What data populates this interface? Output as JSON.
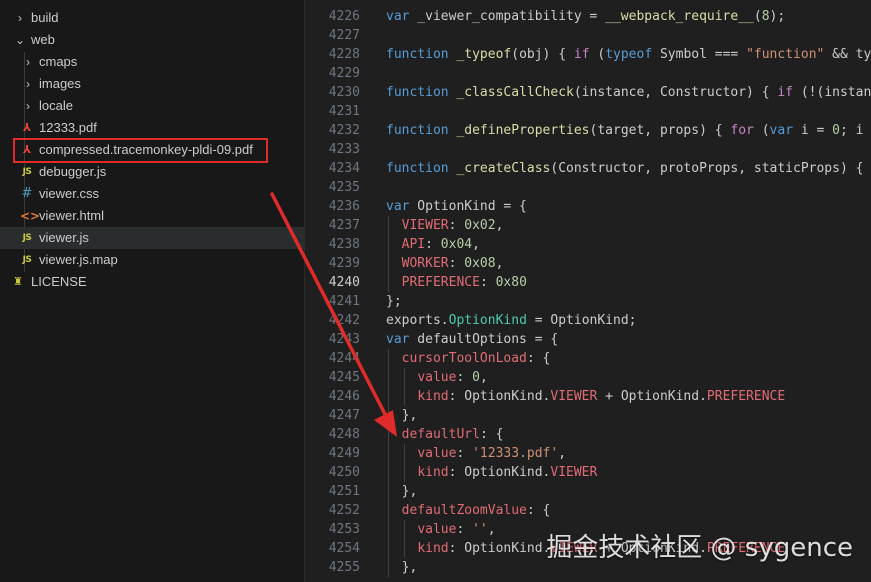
{
  "explorer": {
    "items": [
      {
        "label": "build",
        "chevron": "›",
        "icon": ""
      },
      {
        "label": "web",
        "chevron": "⌄",
        "icon": ""
      },
      {
        "label": "cmaps",
        "chevron": "›",
        "icon": ""
      },
      {
        "label": "images",
        "chevron": "›",
        "icon": ""
      },
      {
        "label": "locale",
        "chevron": "›",
        "icon": ""
      },
      {
        "label": "12333.pdf",
        "chevron": "",
        "icon": "⅄"
      },
      {
        "label": "compressed.tracemonkey-pldi-09.pdf",
        "chevron": "",
        "icon": "⅄"
      },
      {
        "label": "debugger.js",
        "chevron": "",
        "icon": "JS"
      },
      {
        "label": "viewer.css",
        "chevron": "",
        "icon": "#"
      },
      {
        "label": "viewer.html",
        "chevron": "",
        "icon": "<>"
      },
      {
        "label": "viewer.js",
        "chevron": "",
        "icon": "JS"
      },
      {
        "label": "viewer.js.map",
        "chevron": "",
        "icon": "JS"
      },
      {
        "label": "LICENSE",
        "chevron": "",
        "icon": "♜"
      }
    ]
  },
  "editor": {
    "lines": [
      {
        "n": "4226",
        "t": [
          [
            "kw",
            "var"
          ],
          [
            "pun",
            " _viewer_compatibility = "
          ],
          [
            "fn",
            "__webpack_require__"
          ],
          [
            "pun",
            "("
          ],
          [
            "num",
            "8"
          ],
          [
            "pun",
            ");"
          ]
        ]
      },
      {
        "n": "4227",
        "t": []
      },
      {
        "n": "4228",
        "t": [
          [
            "kw",
            "function"
          ],
          [
            "pun",
            " "
          ],
          [
            "fn",
            "_typeof"
          ],
          [
            "pun",
            "(obj) { "
          ],
          [
            "ctrl",
            "if"
          ],
          [
            "pun",
            " ("
          ],
          [
            "kw",
            "typeof"
          ],
          [
            "pun",
            " Symbol === "
          ],
          [
            "str",
            "\"function\""
          ],
          [
            "pun",
            " && typ"
          ]
        ]
      },
      {
        "n": "4229",
        "t": []
      },
      {
        "n": "4230",
        "t": [
          [
            "kw",
            "function"
          ],
          [
            "pun",
            " "
          ],
          [
            "fn",
            "_classCallCheck"
          ],
          [
            "pun",
            "(instance, Constructor) { "
          ],
          [
            "ctrl",
            "if"
          ],
          [
            "pun",
            " (!(instanc"
          ]
        ]
      },
      {
        "n": "4231",
        "t": []
      },
      {
        "n": "4232",
        "t": [
          [
            "kw",
            "function"
          ],
          [
            "pun",
            " "
          ],
          [
            "fn",
            "_defineProperties"
          ],
          [
            "pun",
            "(target, props) { "
          ],
          [
            "ctrl",
            "for"
          ],
          [
            "pun",
            " ("
          ],
          [
            "kw",
            "var"
          ],
          [
            "pun",
            " i = "
          ],
          [
            "num",
            "0"
          ],
          [
            "pun",
            "; i <"
          ]
        ]
      },
      {
        "n": "4233",
        "t": []
      },
      {
        "n": "4234",
        "t": [
          [
            "kw",
            "function"
          ],
          [
            "pun",
            " "
          ],
          [
            "fn",
            "_createClass"
          ],
          [
            "pun",
            "(Constructor, protoProps, staticProps) { i"
          ]
        ]
      },
      {
        "n": "4235",
        "t": []
      },
      {
        "n": "4236",
        "t": [
          [
            "kw",
            "var"
          ],
          [
            "pun",
            " OptionKind = {"
          ]
        ]
      },
      {
        "n": "4237",
        "t": [
          [
            "pun",
            "  "
          ],
          [
            "prop",
            "VIEWER"
          ],
          [
            "pun",
            ": "
          ],
          [
            "num",
            "0x02"
          ],
          [
            "pun",
            ","
          ]
        ]
      },
      {
        "n": "4238",
        "t": [
          [
            "pun",
            "  "
          ],
          [
            "prop",
            "API"
          ],
          [
            "pun",
            ": "
          ],
          [
            "num",
            "0x04"
          ],
          [
            "pun",
            ","
          ]
        ]
      },
      {
        "n": "4239",
        "t": [
          [
            "pun",
            "  "
          ],
          [
            "prop",
            "WORKER"
          ],
          [
            "pun",
            ": "
          ],
          [
            "num",
            "0x08"
          ],
          [
            "pun",
            ","
          ]
        ]
      },
      {
        "n": "4240",
        "t": [
          [
            "pun",
            "  "
          ],
          [
            "prop",
            "PREFERENCE"
          ],
          [
            "pun",
            ": "
          ],
          [
            "num",
            "0x80"
          ]
        ]
      },
      {
        "n": "4241",
        "t": [
          [
            "pun",
            "};"
          ]
        ]
      },
      {
        "n": "4242",
        "t": [
          [
            "pun",
            "exports."
          ],
          [
            "cls",
            "OptionKind"
          ],
          [
            "pun",
            " = OptionKind;"
          ]
        ]
      },
      {
        "n": "4243",
        "t": [
          [
            "kw",
            "var"
          ],
          [
            "pun",
            " defaultOptions = {"
          ]
        ]
      },
      {
        "n": "4244",
        "t": [
          [
            "pun",
            "  "
          ],
          [
            "prop",
            "cursorToolOnLoad"
          ],
          [
            "pun",
            ": {"
          ]
        ]
      },
      {
        "n": "4245",
        "t": [
          [
            "pun",
            "    "
          ],
          [
            "prop",
            "value"
          ],
          [
            "pun",
            ": "
          ],
          [
            "num",
            "0"
          ],
          [
            "pun",
            ","
          ]
        ]
      },
      {
        "n": "4246",
        "t": [
          [
            "pun",
            "    "
          ],
          [
            "prop",
            "kind"
          ],
          [
            "pun",
            ": OptionKind."
          ],
          [
            "prop",
            "VIEWER"
          ],
          [
            "pun",
            " + OptionKind."
          ],
          [
            "prop",
            "PREFERENCE"
          ]
        ]
      },
      {
        "n": "4247",
        "t": [
          [
            "pun",
            "  },"
          ]
        ]
      },
      {
        "n": "4248",
        "t": [
          [
            "pun",
            "  "
          ],
          [
            "prop",
            "defaultUrl"
          ],
          [
            "pun",
            ": {"
          ]
        ]
      },
      {
        "n": "4249",
        "t": [
          [
            "pun",
            "    "
          ],
          [
            "prop",
            "value"
          ],
          [
            "pun",
            ": "
          ],
          [
            "str",
            "'12333.pdf'"
          ],
          [
            "pun",
            ","
          ]
        ]
      },
      {
        "n": "4250",
        "t": [
          [
            "pun",
            "    "
          ],
          [
            "prop",
            "kind"
          ],
          [
            "pun",
            ": OptionKind."
          ],
          [
            "prop",
            "VIEWER"
          ]
        ]
      },
      {
        "n": "4251",
        "t": [
          [
            "pun",
            "  },"
          ]
        ]
      },
      {
        "n": "4252",
        "t": [
          [
            "pun",
            "  "
          ],
          [
            "prop",
            "defaultZoomValue"
          ],
          [
            "pun",
            ": {"
          ]
        ]
      },
      {
        "n": "4253",
        "t": [
          [
            "pun",
            "    "
          ],
          [
            "prop",
            "value"
          ],
          [
            "pun",
            ": "
          ],
          [
            "str",
            "''"
          ],
          [
            "pun",
            ","
          ]
        ]
      },
      {
        "n": "4254",
        "t": [
          [
            "pun",
            "    "
          ],
          [
            "prop",
            "kind"
          ],
          [
            "pun",
            ": OptionKind."
          ],
          [
            "prop",
            "VIEWER"
          ],
          [
            "pun",
            " + OptionKind."
          ],
          [
            "prop",
            "PREFERENCE"
          ]
        ]
      },
      {
        "n": "4255",
        "t": [
          [
            "pun",
            "  },"
          ]
        ]
      }
    ],
    "current_line": "4240"
  },
  "watermark": "掘金技术社区 @ sygence",
  "colors": {
    "highlight_box": "#e02b2b",
    "arrow": "#e02b2b"
  }
}
